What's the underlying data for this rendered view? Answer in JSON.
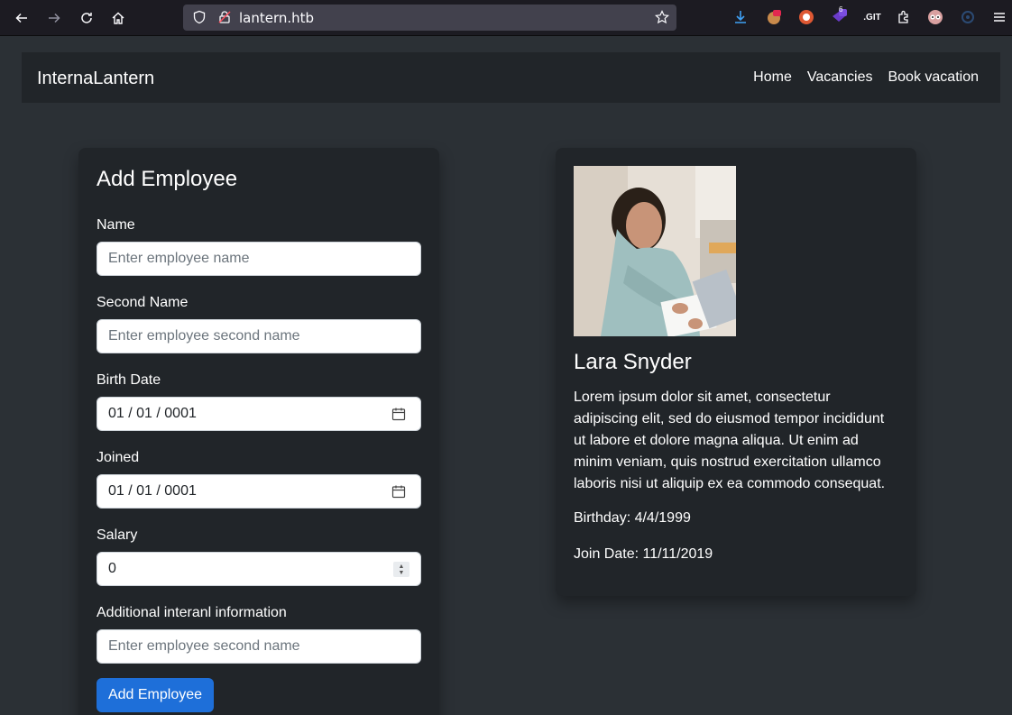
{
  "browser": {
    "url": "lantern.htb",
    "extension_badge": "6",
    "git_label": ".GIT"
  },
  "navbar": {
    "brand": "InternaLantern",
    "links": [
      "Home",
      "Vacancies",
      "Book vacation"
    ]
  },
  "form": {
    "title": "Add Employee",
    "name_label": "Name",
    "name_placeholder": "Enter employee name",
    "second_name_label": "Second Name",
    "second_name_placeholder": "Enter employee second name",
    "birth_label": "Birth Date",
    "birth_value": "01 / 01 / 0001",
    "joined_label": "Joined",
    "joined_value": "01 / 01 / 0001",
    "salary_label": "Salary",
    "salary_value": "0",
    "info_label": "Additional interanl information",
    "info_placeholder": "Enter employee second name",
    "submit_label": "Add Employee"
  },
  "profile": {
    "name": "Lara Snyder",
    "bio": "Lorem ipsum dolor sit amet, consectetur adipiscing elit, sed do eiusmod tempor incididunt ut labore et dolore magna aliqua. Ut enim ad minim veniam, quis nostrud exercitation ullamco laboris nisi ut aliquip ex ea commodo consequat.",
    "birthday": "Birthday: 4/4/1999",
    "join_date": "Join Date: 11/11/2019"
  },
  "colors": {
    "page_bg": "#2b3035",
    "card_bg": "#212529",
    "primary": "#0d6efd"
  }
}
